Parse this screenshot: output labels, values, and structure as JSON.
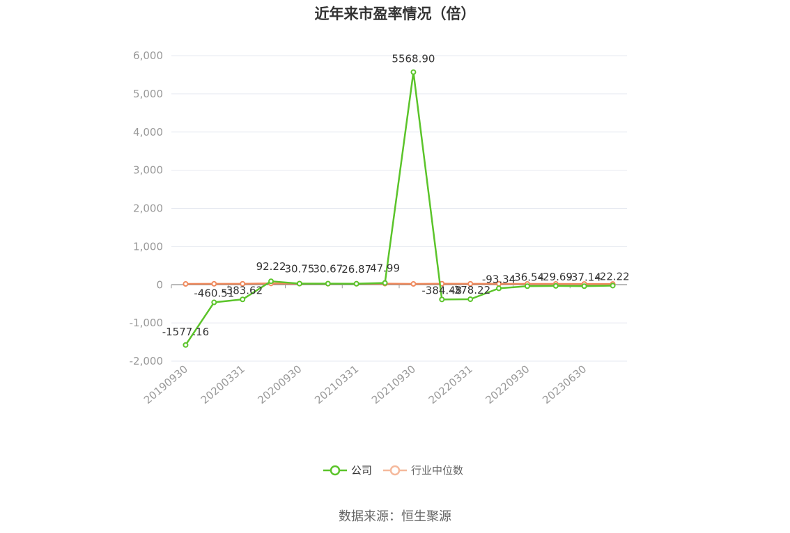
{
  "chart_data": {
    "type": "line",
    "title": "近年来市盈率情况（倍）",
    "ylim": [
      -2000,
      6000
    ],
    "yticks": [
      -2000,
      -1000,
      0,
      1000,
      2000,
      3000,
      4000,
      5000,
      6000
    ],
    "ytick_labels": [
      "-2,000",
      "-1,000",
      "0",
      "1,000",
      "2,000",
      "3,000",
      "4,000",
      "5,000",
      "6,000"
    ],
    "x": [
      "20190930",
      "20191231",
      "20200331",
      "20200630",
      "20200930",
      "20201231",
      "20210331",
      "20210630",
      "20210930",
      "20211231",
      "20220331",
      "20220630",
      "20220930",
      "20221231",
      "20230630",
      "20230930"
    ],
    "xtick_labels": [
      "20190930",
      "20200331",
      "20200930",
      "20210331",
      "20210930",
      "20220331",
      "20220930",
      "20230630"
    ],
    "grid": true,
    "legend_position": "bottom",
    "series": [
      {
        "name": "公司",
        "color": "#5bc42a",
        "values": [
          -1577.16,
          -460.51,
          -383.62,
          92.22,
          30.75,
          30.67,
          26.87,
          47.99,
          5568.9,
          -384.48,
          -378.22,
          -93.34,
          -36.54,
          -29.69,
          -37.14,
          -22.22
        ],
        "labels": [
          "-1577.16",
          "-460.51",
          "-383.62",
          "92.22",
          "30.75",
          "30.67",
          "26.87",
          "47.99",
          "5568.90",
          "-384.48",
          "-378.22",
          "-93.34",
          "-36.54",
          "-29.69",
          "-37.14",
          "-22.22"
        ]
      },
      {
        "name": "行业中位数",
        "color": "#f08a5d",
        "values": [
          22,
          24,
          26,
          35,
          30,
          28,
          27,
          30,
          22,
          28,
          26,
          24,
          22,
          22,
          21,
          20
        ]
      }
    ]
  },
  "source_text": "数据来源：恒生聚源"
}
